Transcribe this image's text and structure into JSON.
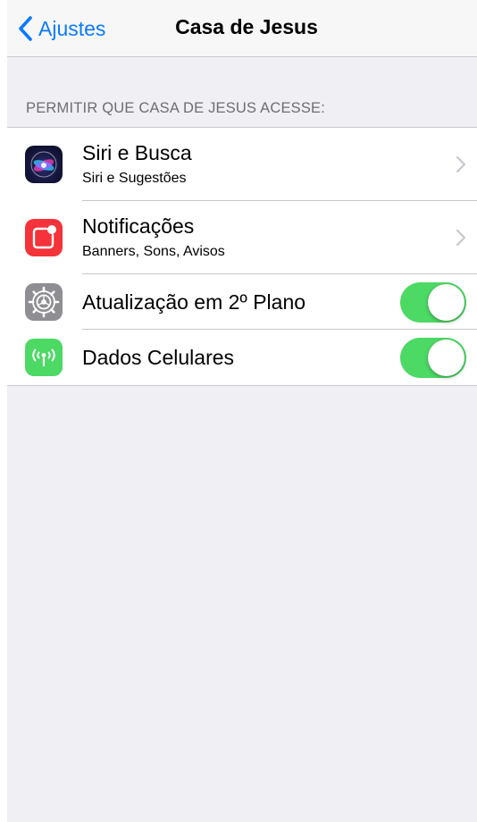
{
  "navbar": {
    "back_label": "Ajustes",
    "title": "Casa de Jesus"
  },
  "section": {
    "header": "PERMITIR QUE CASA DE JESUS ACESSE:"
  },
  "rows": [
    {
      "title": "Siri e Busca",
      "subtitle": "Siri e Sugestões",
      "icon": "siri-icon",
      "accessory": "chevron"
    },
    {
      "title": "Notificações",
      "subtitle": "Banners, Sons, Avisos",
      "icon": "notifications-icon",
      "accessory": "chevron"
    },
    {
      "title": "Atualização em 2º Plano",
      "icon": "gear-icon",
      "accessory": "toggle",
      "toggle_on": true
    },
    {
      "title": "Dados Celulares",
      "icon": "cellular-antenna-icon",
      "accessory": "toggle",
      "toggle_on": true
    }
  ],
  "colors": {
    "accent": "#0a7aff",
    "toggle_on": "#4cd964",
    "background": "#efeff4",
    "notification_icon": "#f4333a",
    "settings_icon": "#8e8e93",
    "cellular_icon": "#4cd964"
  }
}
